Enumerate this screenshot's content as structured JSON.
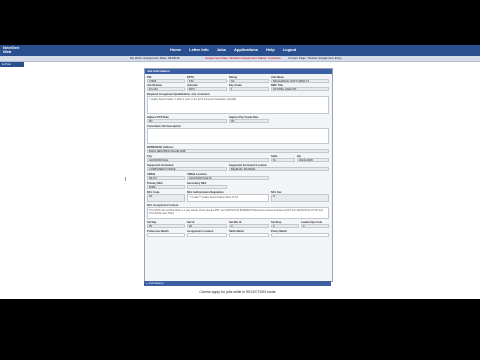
{
  "app": {
    "logo_line1": "NextGen",
    "logo_line2": "Web",
    "tab": "E-Post"
  },
  "nav": [
    "Home",
    "Letter Info",
    "Jobs",
    "Applications",
    "Help",
    "Logout"
  ],
  "subbar": {
    "left": "My Work: Assignment Date: 09/18/18",
    "middle": "Assignment Date: Workers Assignment Status: Complete",
    "right": "Current Page: Tracker Assignment Entry"
  },
  "panel": {
    "title": "Job Information",
    "fields": {
      "pin": {
        "label": "PIN",
        "value": "47906"
      },
      "rptg": {
        "label": "RPTG",
        "value": "T60"
      },
      "rating": {
        "label": "Rating",
        "value": "SK"
      },
      "unit_name": {
        "label": "Unit Name",
        "value": "BACHARACH SUPT GPER CT"
      },
      "job_number": {
        "label": "Job Number",
        "value": "FN-103"
      },
      "jobcode": {
        "label": "Jobcode",
        "value": "8674"
      },
      "pay_grade": {
        "label": "Pay Grade",
        "value": "1"
      },
      "nmc_title": {
        "label": "NMC Title",
        "value": "SP INTEL ANALYST"
      },
      "assignment_note_label": "Required Assignment Qualification, incl. Comment",
      "assignment_note": "* Quality Determination: 1 Mold 4 years in the 0272 Personnel Subsidiary (INAME)",
      "pcp_date": {
        "label": "Highest PCP Date",
        "value": "9N"
      },
      "pay_grade_date": {
        "label": "Highest Pay Grade Date",
        "value": "9N"
      },
      "comment_label": "Consultant Job Description",
      "workdesc_label": "WORKDESC Address",
      "workdesc": "BLDG NEW BRIG PHASE 9OB",
      "city": {
        "label": "City",
        "value": "JACKSONVILLE"
      },
      "state": {
        "label": "State",
        "value": "FL"
      },
      "zip": {
        "label": "Zip",
        "value": "32212-0045"
      },
      "supported_command": {
        "label": "Supported Command",
        "value": "COMPONENT FORCE"
      },
      "supported_location": {
        "label": "Supported Command Location",
        "value": "BAHRAIN, MANAMA"
      },
      "uimlb": {
        "label": "UIMLB",
        "value": "N4173"
      },
      "uimlb_location": {
        "label": "UIMLB Location",
        "value": "JACKSONVILLE FL"
      },
      "primary_nec": {
        "label": "Primary NEC",
        "value": "9O8A"
      },
      "secondary_nec": {
        "label": "Secondary NEC",
        "value": ""
      },
      "ncl_code": {
        "label": "NCL Code",
        "value": "0A"
      },
      "ncl_authorization": {
        "label": "NCL Authorization Regulation",
        "value": "** A valid ** Quality Determination SE-N 13 ST"
      },
      "ncl_fax": {
        "label": "NCL Fax",
        "value": "N"
      },
      "ncl_comment_label": "NCL Assignment Content",
      "ncl_comment": "This NOTA ride certified within a 1 year activity of the relevant PNT, and JAROVIOUS BAIRMENT Manual for relevant activities at PNT and JAROVIOUS of PNT and TICA DIVIS-wide TAGS",
      "sel_day": {
        "label": "Sel Day",
        "value": "45"
      },
      "sel_hr": {
        "label": "Sel Hr",
        "value": "45"
      },
      "sel_min_hr": {
        "label": "Sel Min Hr",
        "value": "0"
      },
      "sel_stop": {
        "label": "Sel Stop",
        "value": "0"
      },
      "leadership_code": {
        "label": "Leadership Code",
        "value": "0"
      },
      "preference_match": {
        "label": "Preference Match",
        "value": ""
      },
      "assignment_location": {
        "label": "Assignment Location",
        "value": ""
      },
      "skills_match": {
        "label": "Skills Match",
        "value": ""
      },
      "policy_match": {
        "label": "Policy Match",
        "value": ""
      }
    }
  },
  "footer_label": "Job History",
  "status_message": "Cannot apply for jobs while in SELECTION mode"
}
